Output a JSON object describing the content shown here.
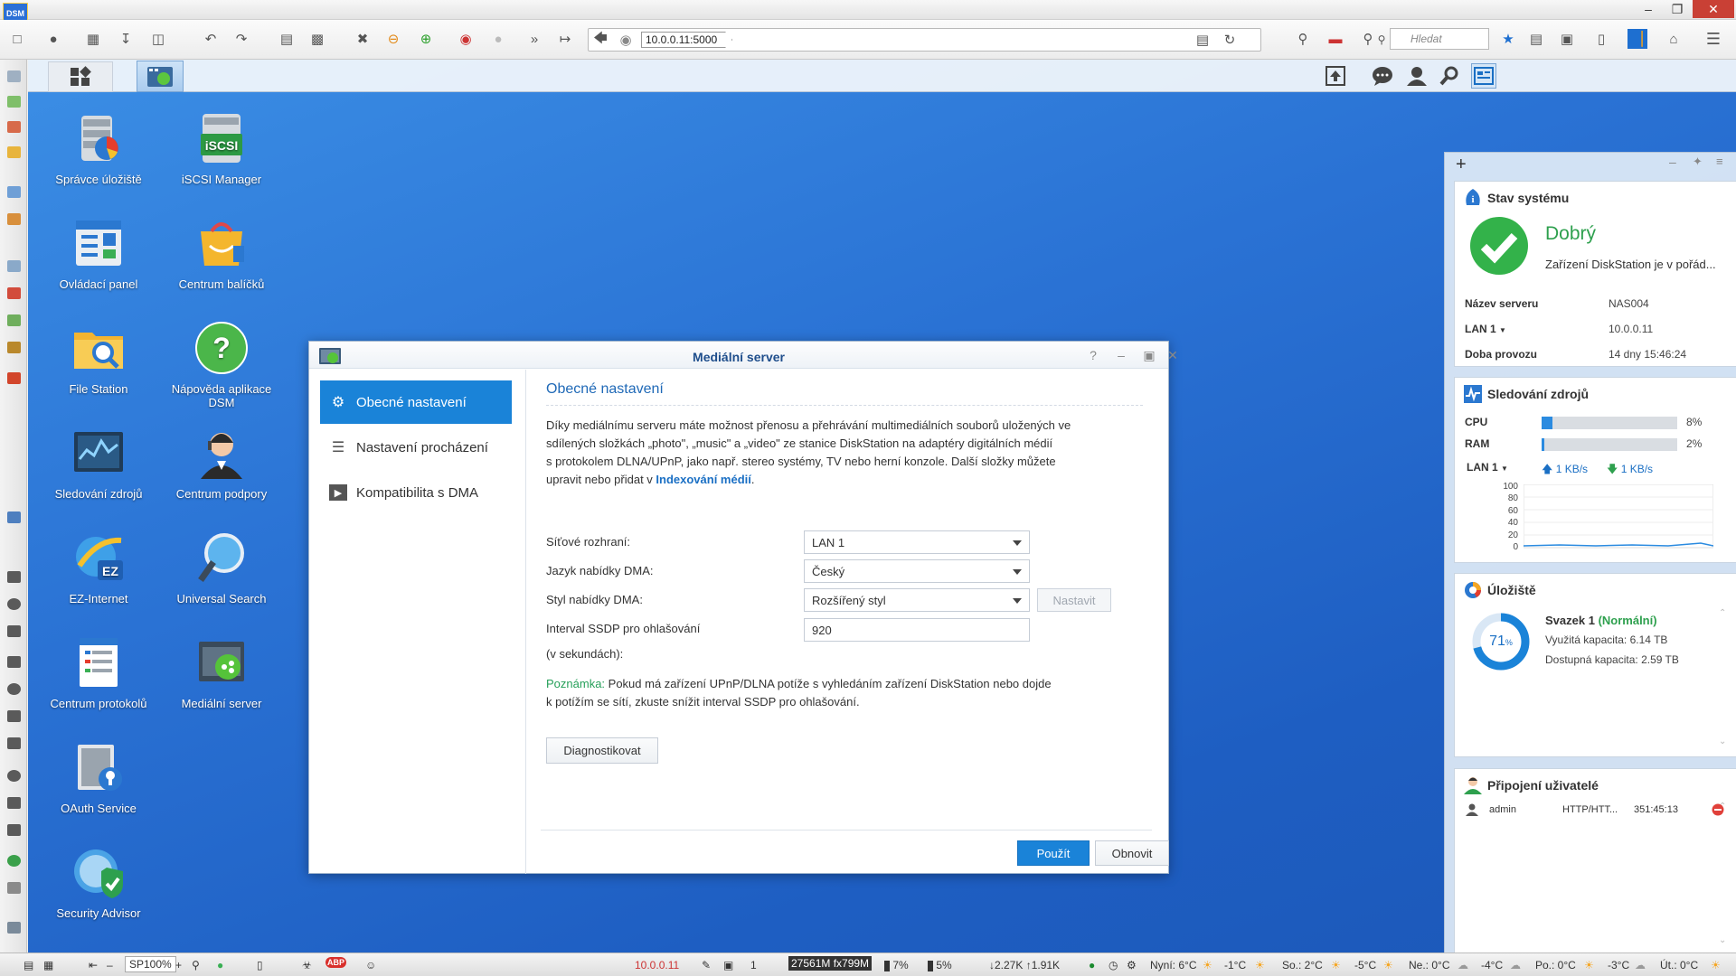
{
  "browser": {
    "logo": "DSM",
    "url": "10.0.0.11:5000",
    "search_placeholder": "Hledat"
  },
  "desktop": {
    "icons": [
      {
        "label": "Správce úložiště",
        "icon": "storage-manager-icon"
      },
      {
        "label": "iSCSI Manager",
        "icon": "iscsi-icon"
      },
      {
        "label": "Ovládací panel",
        "icon": "control-panel-icon"
      },
      {
        "label": "Centrum balíčků",
        "icon": "package-center-icon"
      },
      {
        "label": "File Station",
        "icon": "file-station-icon"
      },
      {
        "label": "Nápověda aplikace DSM",
        "icon": "help-icon"
      },
      {
        "label": "Sledování zdrojů",
        "icon": "resource-monitor-icon"
      },
      {
        "label": "Centrum podpory",
        "icon": "support-center-icon"
      },
      {
        "label": "EZ-Internet",
        "icon": "ez-internet-icon"
      },
      {
        "label": "Universal Search",
        "icon": "universal-search-icon"
      },
      {
        "label": "Centrum protokolů",
        "icon": "log-center-icon"
      },
      {
        "label": "Mediální server",
        "icon": "media-server-icon"
      },
      {
        "label": "OAuth Service",
        "icon": "oauth-icon"
      },
      {
        "label": "Security Advisor",
        "icon": "security-advisor-icon"
      }
    ]
  },
  "dialog": {
    "title": "Mediální server",
    "nav": [
      {
        "label": "Obecné nastavení"
      },
      {
        "label": "Nastavení procházení"
      },
      {
        "label": "Kompatibilita s DMA"
      }
    ],
    "section_title": "Obecné nastavení",
    "desc_l1": "Díky mediálnímu serveru máte možnost přenosu a přehrávání multimediálních souborů uložených ve",
    "desc_l2": "sdílených složkách „photo\", „music\" a „video\" ze stanice DiskStation na adaptéry digitálních médií",
    "desc_l3": "s protokolem DLNA/UPnP, jako např. stereo systémy, TV nebo herní konzole. Další složky můžete",
    "desc_l4a": "upravit nebo přidat v ",
    "desc_link": "Indexování médií",
    "desc_l4b": ".",
    "fields": {
      "iface_label": "Síťové rozhraní:",
      "iface_value": "LAN 1",
      "lang_label": "Jazyk nabídky DMA:",
      "lang_value": "Český",
      "style_label": "Styl nabídky DMA:",
      "style_value": "Rozšířený styl",
      "set_button": "Nastavit",
      "ssdp_label1": "Interval SSDP pro ohlašování",
      "ssdp_label2": "(v sekundách):",
      "ssdp_value": "920"
    },
    "note_prefix": "Poznámka:",
    "note_l1": " Pokud má zařízení UPnP/DLNA potíže s vyhledáním zařízení DiskStation nebo dojde",
    "note_l2": "k potížím se sítí, zkuste snížit interval SSDP pro ohlašování.",
    "diag_button": "Diagnostikovat",
    "apply_button": "Použít",
    "reset_button": "Obnovit"
  },
  "widgets": {
    "system": {
      "title": "Stav systému",
      "status": "Dobrý",
      "status_desc": "Zařízení DiskStation je v pořád...",
      "server_name_label": "Název serveru",
      "server_name": "NAS004",
      "lan_label": "LAN 1",
      "lan_value": "10.0.0.11",
      "uptime_label": "Doba provozu",
      "uptime_value": "14 dny 15:46:24"
    },
    "resources": {
      "title": "Sledování zdrojů",
      "cpu_label": "CPU",
      "cpu_pct": 8,
      "cpu_text": "8%",
      "ram_label": "RAM",
      "ram_pct": 2,
      "ram_text": "2%",
      "lan_label": "LAN 1",
      "up": "1 KB/s",
      "down": "1 KB/s",
      "y_ticks": [
        "100",
        "80",
        "60",
        "40",
        "20",
        "0"
      ]
    },
    "storage": {
      "title": "Úložiště",
      "usage_pct": 71,
      "usage_text": "71",
      "usage_unit": "%",
      "volume": "Svazek 1",
      "volume_status": "(Normální)",
      "used": "Využitá kapacita: 6.14 TB",
      "free": "Dostupná kapacita: 2.59 TB"
    },
    "users": {
      "title": "Připojení uživatelé",
      "user": "admin",
      "protocol": "HTTP/HTT...",
      "time": "351:45:13"
    }
  },
  "statusbar": {
    "zoom": "SP100%",
    "ip": "10.0.0.11",
    "tab_count": "1",
    "memory": "27561M fx799M",
    "cpu": "7%",
    "disk": "5%",
    "net": "↓2.27K ↑1.91K",
    "weather": [
      {
        "day": "Nyní: 6°C",
        "low": "-1°C"
      },
      {
        "day": "So.: 2°C",
        "low": "-5°C"
      },
      {
        "day": "Ne.: 0°C",
        "low": "-4°C"
      },
      {
        "day": "Po.: 0°C",
        "low": "-3°C"
      },
      {
        "day": "Út.: 0°C",
        "low": ""
      }
    ]
  }
}
